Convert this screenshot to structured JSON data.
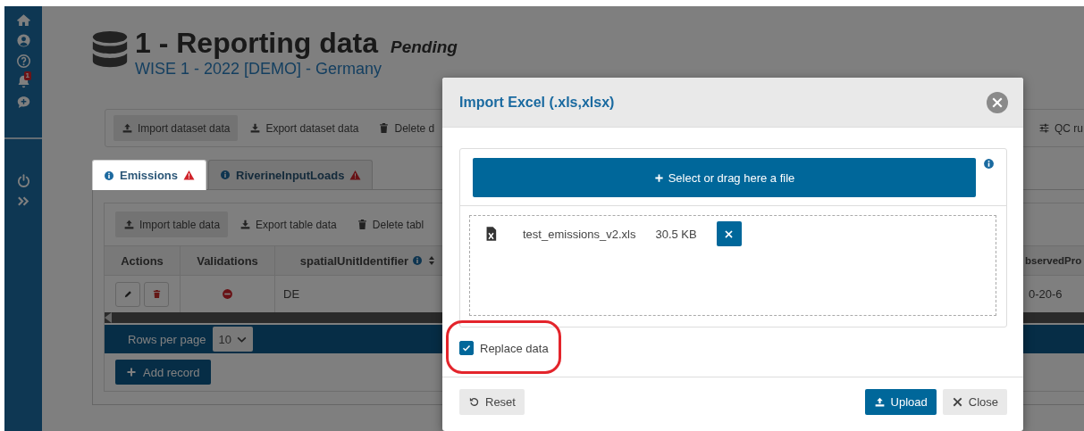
{
  "sidebar": {
    "top_items": [
      {
        "kind": "home"
      },
      {
        "kind": "user"
      },
      {
        "kind": "help"
      },
      {
        "kind": "bell",
        "badge": "1"
      },
      {
        "kind": "chat"
      }
    ],
    "bottom_items": [
      {
        "kind": "power"
      },
      {
        "kind": "expand"
      }
    ]
  },
  "header": {
    "title": "1 - Reporting data",
    "status": "Pending",
    "subtitle": "WISE 1 - 2022 [DEMO] - Germany"
  },
  "dataset_toolbar": [
    {
      "kind": "upload",
      "label": "Import dataset data",
      "selected": true
    },
    {
      "kind": "download",
      "label": "Export dataset data",
      "selected": false
    },
    {
      "kind": "trash",
      "label": "Delete d",
      "selected": false
    },
    {
      "kind": "sliders",
      "label": "QC ru",
      "selected": false
    }
  ],
  "tabs": [
    {
      "label": "Emissions",
      "selected": true,
      "warning": true
    },
    {
      "label": "RiverineInputLoads",
      "selected": false,
      "warning": true
    }
  ],
  "table_toolbar": [
    {
      "kind": "upload",
      "label": "Import table data",
      "selected": true
    },
    {
      "kind": "download",
      "label": "Export table data",
      "selected": false
    },
    {
      "kind": "trash",
      "label": "Delete tabl",
      "selected": false
    }
  ],
  "table": {
    "columns": [
      {
        "label": "Actions",
        "info": false,
        "sortable": false
      },
      {
        "label": "Validations",
        "info": false,
        "sortable": false
      },
      {
        "label": "spatialUnitIdentifier",
        "info": true,
        "sortable": true
      },
      {
        "label": "bservedPro",
        "info": false,
        "sortable": false
      }
    ],
    "rows": [
      {
        "validation_error": true,
        "cells": [
          "",
          "",
          "DE",
          "0-20-6"
        ]
      }
    ]
  },
  "pagination": {
    "label": "Rows per page",
    "value": "10"
  },
  "add_button": "Add record",
  "modal": {
    "title": "Import Excel (.xls,xlsx)",
    "select_label": "Select or drag here a file",
    "files": [
      {
        "name": "test_emissions_v2.xls",
        "size": "30.5 KB"
      }
    ],
    "replace_data": {
      "label": "Replace data",
      "checked": true
    },
    "buttons": [
      {
        "kind": "reset",
        "label": "Reset"
      },
      {
        "kind": "upload",
        "label": "Upload"
      },
      {
        "kind": "close",
        "label": "Close"
      }
    ]
  }
}
